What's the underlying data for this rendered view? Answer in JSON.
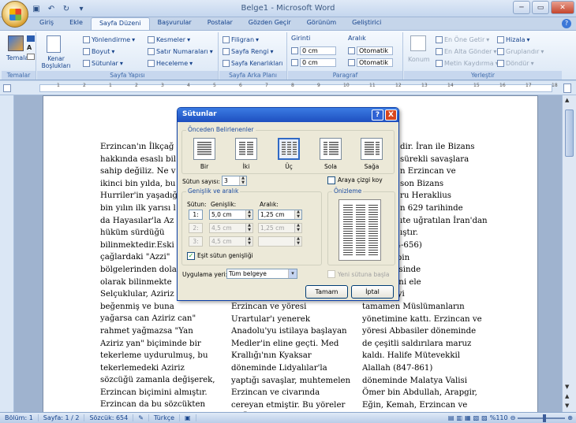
{
  "window": {
    "title": "Belge1 - Microsoft Word"
  },
  "tabs": [
    "Giriş",
    "Ekle",
    "Sayfa Düzeni",
    "Başvurular",
    "Postalar",
    "Gözden Geçir",
    "Görünüm",
    "Geliştirici"
  ],
  "active_tab": "Sayfa Düzeni",
  "ribbon": {
    "temalar": {
      "button": "Temalar",
      "label": "Temalar"
    },
    "sayfa_yapisi": {
      "kenar": "Kenar Boşlukları",
      "yonlendirme": "Yönlendirme",
      "boyut": "Boyut",
      "sutunlar": "Sütunlar",
      "kesmeler": "Kesmeler",
      "satir_numaralari": "Satır Numaraları",
      "heceleme": "Heceleme",
      "label": "Sayfa Yapısı"
    },
    "sayfa_arka_plani": {
      "filigran": "Filigran",
      "sayfa_rengi": "Sayfa Rengi",
      "sayfa_kenarliklari": "Sayfa Kenarlıkları",
      "label": "Sayfa Arka Planı"
    },
    "paragraf": {
      "girinti": "Girinti",
      "aralik": "Aralık",
      "left_indent": "0 cm",
      "right_indent": "0 cm",
      "before": "Otomatik",
      "after": "Otomatik",
      "label": "Paragraf"
    },
    "yerlestir": {
      "konum": "Konum",
      "en_one_getir": "En Öne Getir",
      "en_alta_gonder": "En Alta Gönder",
      "metin_kaydirma": "Metin Kaydırma",
      "hizala": "Hizala",
      "grupla": "Gruplandır",
      "dondur": "Döndür",
      "label": "Yerleştir"
    }
  },
  "ruler_numbers": [
    "1",
    "2",
    "1",
    "2",
    "3",
    "4",
    "5",
    "6",
    "7",
    "8",
    "9",
    "10",
    "11",
    "12",
    "13",
    "14",
    "15",
    "16",
    "17",
    "18"
  ],
  "document": {
    "col1": [
      "Erzincan'ın İlkçağ",
      "hakkında esaslı bil",
      "sahip değiliz. Ne v",
      "ikinci bin yılda, bu",
      "Hurriler'in yaşadığ",
      "bin yılın ilk yarısı l",
      "da Hayasılar'la Az",
      "hüküm sürdüğü",
      "bilinmektedir.Eski",
      "çağlardaki \"Azzi\"",
      "bölgelerinden dola",
      "olarak bilinmekte",
      "Selçuklular, Aziriz",
      "beğenmiş ve buna",
      "yağarsa can Aziriz can\"",
      "rahmet yağmazsa \"Yan",
      "Aziriz yan\" biçiminde bir",
      "tekerleme uydurulmuş, bu",
      "tekerlemedeki Aziriz",
      "sözcüğü zamanla değişerek,",
      "Erzincan biçimini almıştır.",
      "Erzincan da bu sözcükten",
      "türemiştir"
    ],
    "col2": [
      "Erzincan ve yöresi",
      "Urartular'ı yenerek",
      "Anadolu'yu istilaya başlayan",
      "Medler'in eline geçti. Med",
      "Krallığı'nın Kyaksar",
      "döneminde Lidyalılar'la",
      "yaptığı savaşlar, muhtemelen",
      "Erzincan ve civarında",
      "cereyan etmiştir. Bu yöreler",
      "M.Ö. 550 civarında bu kez"
    ],
    "col3_top": [
      "dir. İran ile Bizans",
      "sürekli savaşlara",
      "n Erzincan ve",
      "son Bizans",
      "ru Heraklius",
      "n 629 tarihinde",
      "ıte uğratılan İran'dan",
      "ıştır."
    ],
    "col3_mid": [
      "man (644-656)",
      "a Habib bin",
      "755 senesinde",
      "ve yöresini ele",
      "bu bölgeyi",
      "tamamen Müslümanların",
      "yönetimine kattı. Erzincan ve",
      "yöresi Abbasiler döneminde",
      "de çeşitli saldırılara maruz",
      "kaldı. Halife Mütevekkil",
      "Alallah (847-861)",
      "döneminde Malatya Valisi",
      "Ömer bin Abdullah, Arapgir,",
      "Eğin, Kemah, Erzincan ve",
      "Trabzon kentlerini"
    ]
  },
  "dialog": {
    "title": "Sütunlar",
    "presets_legend": "Önceden Belirlenenler",
    "presets": [
      "Bir",
      "İki",
      "Üç",
      "Sola",
      "Sağa"
    ],
    "selected_preset": "Üç",
    "sutun_sayisi_label": "Sütun sayısı:",
    "sutun_sayisi": "3",
    "araya_cizgi": "Araya çizgi koy",
    "genislik_legend": "Genişlik ve aralık",
    "onizleme_legend": "Önizleme",
    "col_header": "Sütun:",
    "width_header": "Genişlik:",
    "spacing_header": "Aralık:",
    "rows": [
      {
        "n": "1:",
        "width": "5,0 cm",
        "spacing": "1,25 cm"
      },
      {
        "n": "2:",
        "width": "4,5 cm",
        "spacing": "1,25 cm"
      },
      {
        "n": "3:",
        "width": "4,5 cm",
        "spacing": ""
      }
    ],
    "esit_sutun": "Eşit sütun genişliği",
    "uygulama_label": "Uygulama yeri:",
    "uygulama_value": "Tüm belgeye",
    "yeni_sutuna": "Yeni sütuna başla",
    "ok": "Tamam",
    "cancel": "İptal",
    "help": "?",
    "close": "X"
  },
  "status": {
    "bolum": "Bölüm: 1",
    "sayfa": "Sayfa: 1 / 2",
    "sozcuk": "Sözcük: 654",
    "dil": "Türkçe",
    "zoom": "%110"
  }
}
